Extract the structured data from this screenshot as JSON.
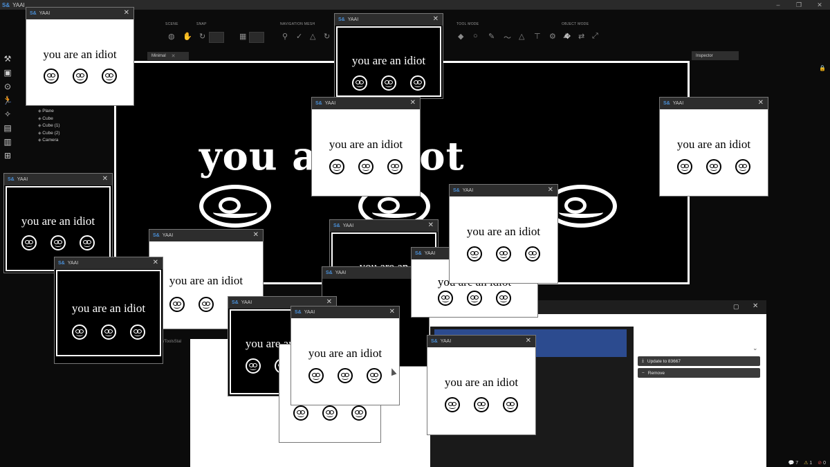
{
  "app": {
    "title": "YAAI",
    "logo": "S&"
  },
  "toolbar": {
    "groups": [
      {
        "label": "SCENE"
      },
      {
        "label": "SNAP"
      },
      {
        "label": "NAVIGATION MESH"
      },
      {
        "label": "TOOL MODE"
      },
      {
        "label": "OBJECT MODE"
      }
    ]
  },
  "tabs": {
    "minimal": "Minimal",
    "inspector": "Inspector"
  },
  "hierarchy": {
    "items": [
      "Plane",
      "Cube",
      "Cube (1)",
      "Cube (2)",
      "Camera"
    ]
  },
  "scene": {
    "text": "you  an idiot"
  },
  "popup": {
    "title": "YAAI",
    "message": "you are an idiot",
    "message_cut1": "you are an",
    "message_cut2": "you are an idiot"
  },
  "panel": {
    "update_label": "Update to 83667",
    "remove_label": "Remove"
  },
  "console": {
    "text": "/ToolsStal"
  },
  "status": {
    "messages": "7",
    "warnings": "1",
    "errors": "0"
  }
}
